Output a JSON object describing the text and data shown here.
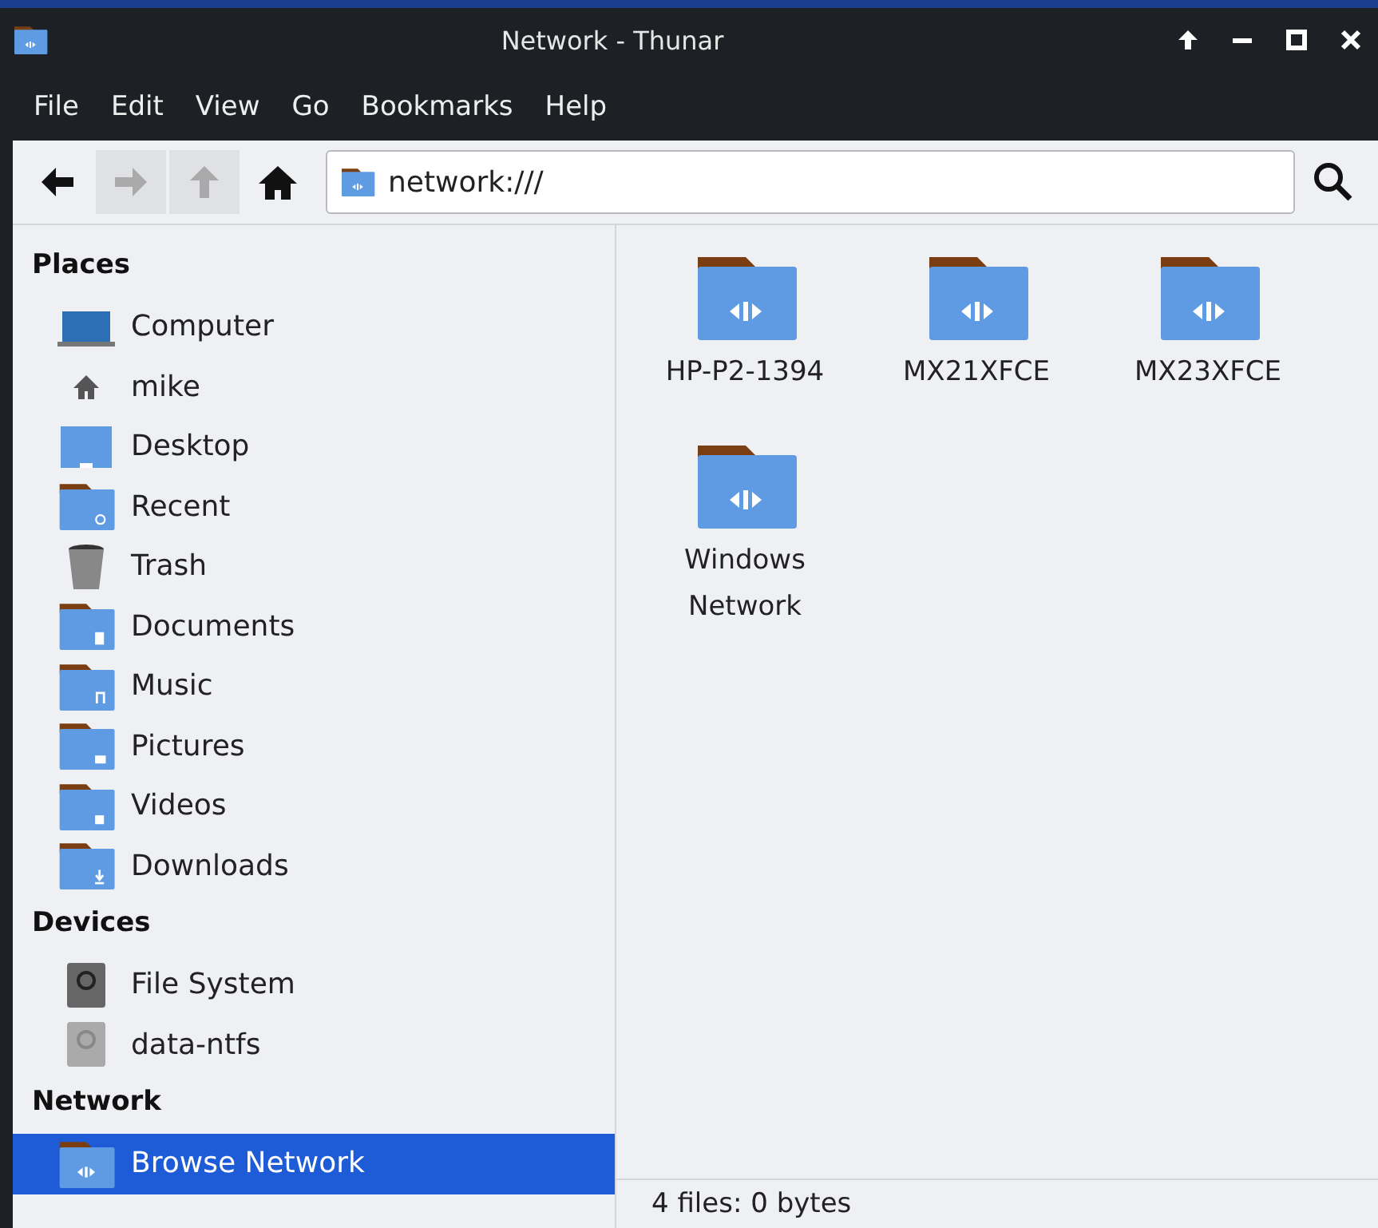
{
  "window": {
    "title": "Network - Thunar"
  },
  "menu": [
    "File",
    "Edit",
    "View",
    "Go",
    "Bookmarks",
    "Help"
  ],
  "toolbar": {
    "buttons": [
      {
        "kind": "back",
        "disabled": false
      },
      {
        "kind": "forward",
        "disabled": true
      },
      {
        "kind": "up",
        "disabled": true
      },
      {
        "kind": "home",
        "disabled": false
      }
    ],
    "location": "network:///"
  },
  "sidebar": {
    "sections": [
      {
        "title": "Places",
        "items": [
          {
            "label": "Computer",
            "kind": "computer",
            "selected": false
          },
          {
            "label": "mike",
            "kind": "home",
            "selected": false
          },
          {
            "label": "Desktop",
            "kind": "desktop",
            "selected": false
          },
          {
            "label": "Recent",
            "kind": "recent",
            "selected": false
          },
          {
            "label": "Trash",
            "kind": "trash",
            "selected": false
          },
          {
            "label": "Documents",
            "kind": "documents",
            "selected": false
          },
          {
            "label": "Music",
            "kind": "music",
            "selected": false
          },
          {
            "label": "Pictures",
            "kind": "pictures",
            "selected": false
          },
          {
            "label": "Videos",
            "kind": "videos",
            "selected": false
          },
          {
            "label": "Downloads",
            "kind": "downloads",
            "selected": false
          }
        ]
      },
      {
        "title": "Devices",
        "items": [
          {
            "label": "File System",
            "kind": "drive",
            "selected": false
          },
          {
            "label": "data-ntfs",
            "kind": "drive-unmounted",
            "selected": false
          }
        ]
      },
      {
        "title": "Network",
        "items": [
          {
            "label": "Browse Network",
            "kind": "network",
            "selected": true
          }
        ]
      }
    ]
  },
  "files": [
    {
      "name": "HP-P2-1394"
    },
    {
      "name": "MX21XFCE"
    },
    {
      "name": "MX23XFCE"
    },
    {
      "name": "Windows Network"
    }
  ],
  "status_bar": "4 files: 0 bytes"
}
